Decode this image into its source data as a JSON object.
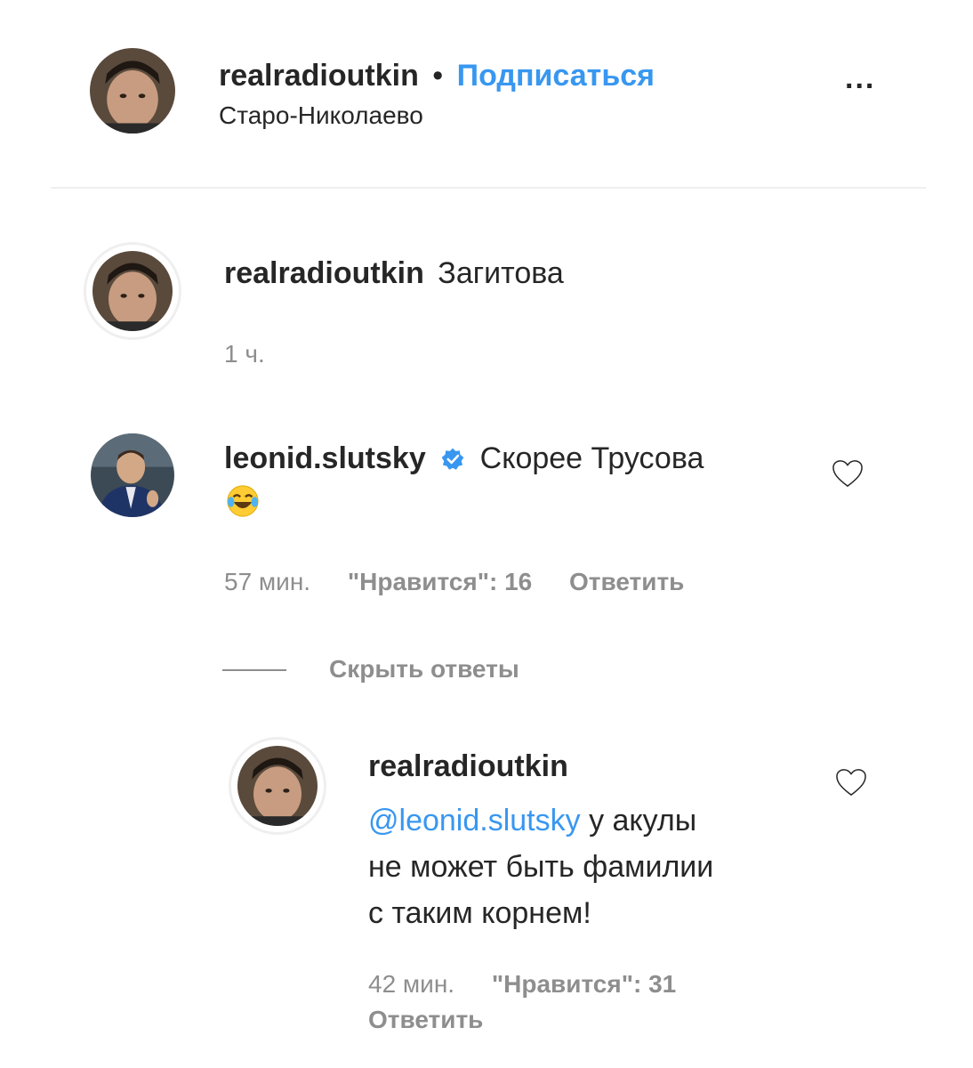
{
  "post_header": {
    "username": "realradioutkin",
    "separator": "•",
    "follow_label": "Подписаться",
    "location": "Старо-Николаево",
    "more_label": "..."
  },
  "caption": {
    "username": "realradioutkin",
    "text": "Загитова",
    "time": "1 ч."
  },
  "comment": {
    "username": "leonid.slutsky",
    "verified": true,
    "text": "Скорее Трусова",
    "emoji": "😂",
    "time": "57 мин.",
    "likes_label": "\"Нравится\": 16",
    "reply_label": "Ответить"
  },
  "replies_toggle": {
    "label": "Скрыть ответы"
  },
  "reply": {
    "username": "realradioutkin",
    "mention": "@leonid.slutsky",
    "text_line1": " у акулы",
    "text_line2": "не может быть фамилии",
    "text_line3": "с таким корнем!",
    "time": "42 мин.",
    "likes_label": "\"Нравится\": 31",
    "reply_label": "Ответить"
  },
  "colors": {
    "link": "#3897f0",
    "muted": "#8e8e8e",
    "text": "#262626",
    "verified": "#3897f0"
  }
}
